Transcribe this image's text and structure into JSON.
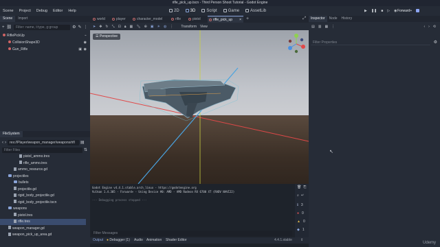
{
  "window": {
    "title": "rifle_pick_up.tscn - Third Person Shoot Tutorial - Godot Engine"
  },
  "menu": [
    "Scene",
    "Project",
    "Debug",
    "Editor",
    "Help"
  ],
  "workspaces": [
    "2D",
    "3D",
    "Script",
    "Game",
    "AssetLib"
  ],
  "renderer": "Forward+",
  "scene_dock": {
    "tabs": [
      "Scene",
      "Import"
    ],
    "filter_placeholder": "Filter: name, t:type, g:group",
    "nodes": [
      {
        "name": "RiflePickUp"
      },
      {
        "name": "CollisionShape3D"
      },
      {
        "name": "Gun_Rifle"
      }
    ]
  },
  "filesystem": {
    "title": "FileSystem",
    "path": "res://Player/weapon_manager/weapons/rifl",
    "filter_placeholder": "Filter Files",
    "items": [
      {
        "name": "pistol_ammo.tres",
        "kind": "file",
        "indent": 3
      },
      {
        "name": "rifle_ammo.tres",
        "kind": "file",
        "indent": 3
      },
      {
        "name": "ammo_resource.gd",
        "kind": "file",
        "indent": 2
      },
      {
        "name": "projectiles",
        "kind": "folder",
        "indent": 1
      },
      {
        "name": "bullets",
        "kind": "folder",
        "indent": 2
      },
      {
        "name": "projectile.gd",
        "kind": "file",
        "indent": 2
      },
      {
        "name": "rigid_body_projectile.gd",
        "kind": "file",
        "indent": 2
      },
      {
        "name": "rigid_body_projectile.tscn",
        "kind": "file",
        "indent": 2
      },
      {
        "name": "weapons",
        "kind": "folder",
        "indent": 1
      },
      {
        "name": "pistol.tres",
        "kind": "file",
        "indent": 2
      },
      {
        "name": "rifle.tres",
        "kind": "file",
        "indent": 2,
        "selected": true
      },
      {
        "name": "weapon_manager.gd",
        "kind": "file",
        "indent": 1
      },
      {
        "name": "weapon_pick_up_area.gd",
        "kind": "file",
        "indent": 1
      }
    ]
  },
  "editor_tabs": [
    "world",
    "player",
    "character_model",
    "rifle",
    "pistol",
    "rifle_pick_up"
  ],
  "viewport": {
    "toolbar": [
      "Transform",
      "View"
    ],
    "perspective_label": "Perspective"
  },
  "console": {
    "lines": [
      "Godot Engine v4.4.1.stable.arch_linux - https://godotengine.org",
      "Vulkan 1.4.305 - Forward+ - Using Device #0: AMD - AMD Radeon RX 6700 XT (RADV NAVI22)",
      "",
      "--- Debugging process stopped ---"
    ],
    "filter_placeholder": "Filter Messages",
    "counts": {
      "errors": "0",
      "warnings": "0",
      "info": "3"
    }
  },
  "bottom_tabs": [
    "Output",
    "Debugger (1)",
    "Audio",
    "Animation",
    "Shader Editor"
  ],
  "version_label": "4.4.1.stable",
  "inspector": {
    "tabs": [
      "Inspector",
      "Node",
      "History"
    ],
    "filter_placeholder": "Filter Properties"
  },
  "watermark": "Udemy",
  "colors": {
    "accent": "#8aa4d8",
    "x_axis": "#e04848",
    "z_axis": "#4aa3e0",
    "y_axis": "#c8d040"
  }
}
